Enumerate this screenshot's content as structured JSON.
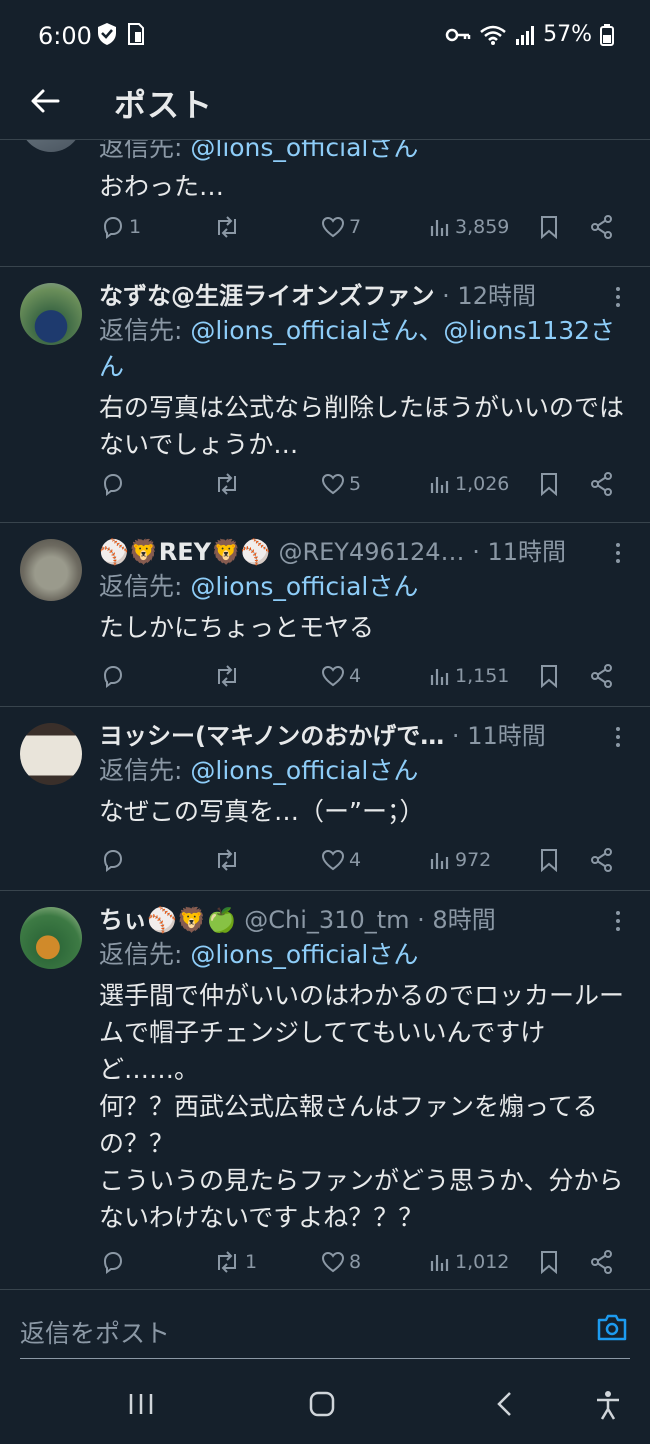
{
  "status_bar": {
    "time": "6:00",
    "battery": "57%"
  },
  "header": {
    "title": "ポスト"
  },
  "tweets": [
    {
      "name": "",
      "handle": "",
      "time": "",
      "reply_prefix": "返信先: ",
      "mentions": "@lions_officialさん",
      "text": "おわった…",
      "replies": "1",
      "retweets": "",
      "likes": "7",
      "views": "3,859"
    },
    {
      "name": "なずな@生涯ライオンズファン",
      "handle": "",
      "time": "12時間",
      "reply_prefix": "返信先: ",
      "mentions": "@lions_officialさん、@lions1132さん",
      "text": "右の写真は公式なら削除したほうがいいのではないでしょうか…",
      "replies": "",
      "retweets": "",
      "likes": "5",
      "views": "1,026"
    },
    {
      "name": "⚾🦁REY🦁⚾",
      "handle": "@REY496124…",
      "time": "11時間",
      "reply_prefix": "返信先: ",
      "mentions": "@lions_officialさん",
      "text": "たしかにちょっとモヤる",
      "replies": "",
      "retweets": "",
      "likes": "4",
      "views": "1,151"
    },
    {
      "name": "ヨッシー(マキノンのおかげで…",
      "handle": "",
      "time": "11時間",
      "reply_prefix": "返信先: ",
      "mentions": "@lions_officialさん",
      "text": "なぜこの写真を…（ー”ー；）",
      "replies": "",
      "retweets": "",
      "likes": "4",
      "views": "972"
    },
    {
      "name": "ちぃ⚾🦁🍏",
      "handle": "@Chi_310_tm",
      "time": "8時間",
      "reply_prefix": "返信先: ",
      "mentions": "@lions_officialさん",
      "text": "選手間で仲がいいのはわかるのでロッカールームで帽子チェンジしててもいいんですけど……。\n何？？西武公式広報さんはファンを煽ってるの？？\nこういうの見たらファンがどう思うか、分からないわけないですよね？？？",
      "replies": "",
      "retweets": "1",
      "likes": "8",
      "views": "1,012"
    }
  ],
  "composer": {
    "placeholder": "返信をポスト"
  },
  "icons": {
    "back": "arrow-left-icon",
    "more": "more-vertical-icon",
    "reply": "reply-icon",
    "retweet": "retweet-icon",
    "like": "heart-icon",
    "views": "views-icon",
    "bookmark": "bookmark-icon",
    "share": "share-icon",
    "camera": "camera-icon"
  },
  "colors": {
    "background": "#15202b",
    "mention": "#8ecdf8",
    "muted": "#8b98a5",
    "divider": "#38444d"
  }
}
